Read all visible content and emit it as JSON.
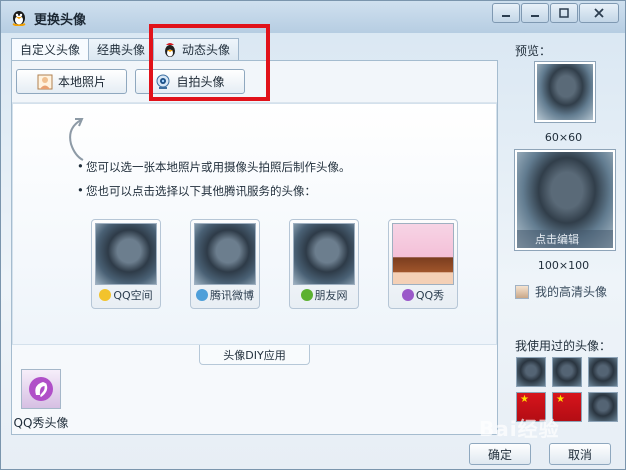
{
  "window": {
    "title": "更换头像"
  },
  "tabs": [
    {
      "label": "自定义头像",
      "active": true
    },
    {
      "label": "经典头像",
      "active": false
    },
    {
      "label": "动态头像",
      "active": false
    }
  ],
  "actions": {
    "local_photo": "本地照片",
    "self_shot": "自拍头像"
  },
  "content": {
    "line1": "您可以选一张本地照片或用摄像头拍照后制作头像。",
    "line2": "您也可以点击选择以下其他腾讯服务的头像："
  },
  "services": [
    {
      "label": "QQ空间",
      "icon": "star-icon"
    },
    {
      "label": "腾讯微博",
      "icon": "weibo-icon"
    },
    {
      "label": "朋友网",
      "icon": "clover-icon"
    },
    {
      "label": "QQ秀",
      "icon": "qqshow-icon"
    }
  ],
  "diy": {
    "label": "头像DIY应用"
  },
  "qqshow_avatar": {
    "label": "QQ秀头像"
  },
  "preview": {
    "title": "预览：",
    "small_size": "60×60",
    "large_size": "100×100",
    "edit_label": "点击编辑"
  },
  "hd_avatar": {
    "label": "我的高清头像"
  },
  "used": {
    "title": "我使用过的头像：",
    "count": 6
  },
  "buttons": {
    "ok": "确定",
    "cancel": "取消"
  },
  "watermark": "Bai经验",
  "colors": {
    "highlight_box": "#e1121a"
  }
}
